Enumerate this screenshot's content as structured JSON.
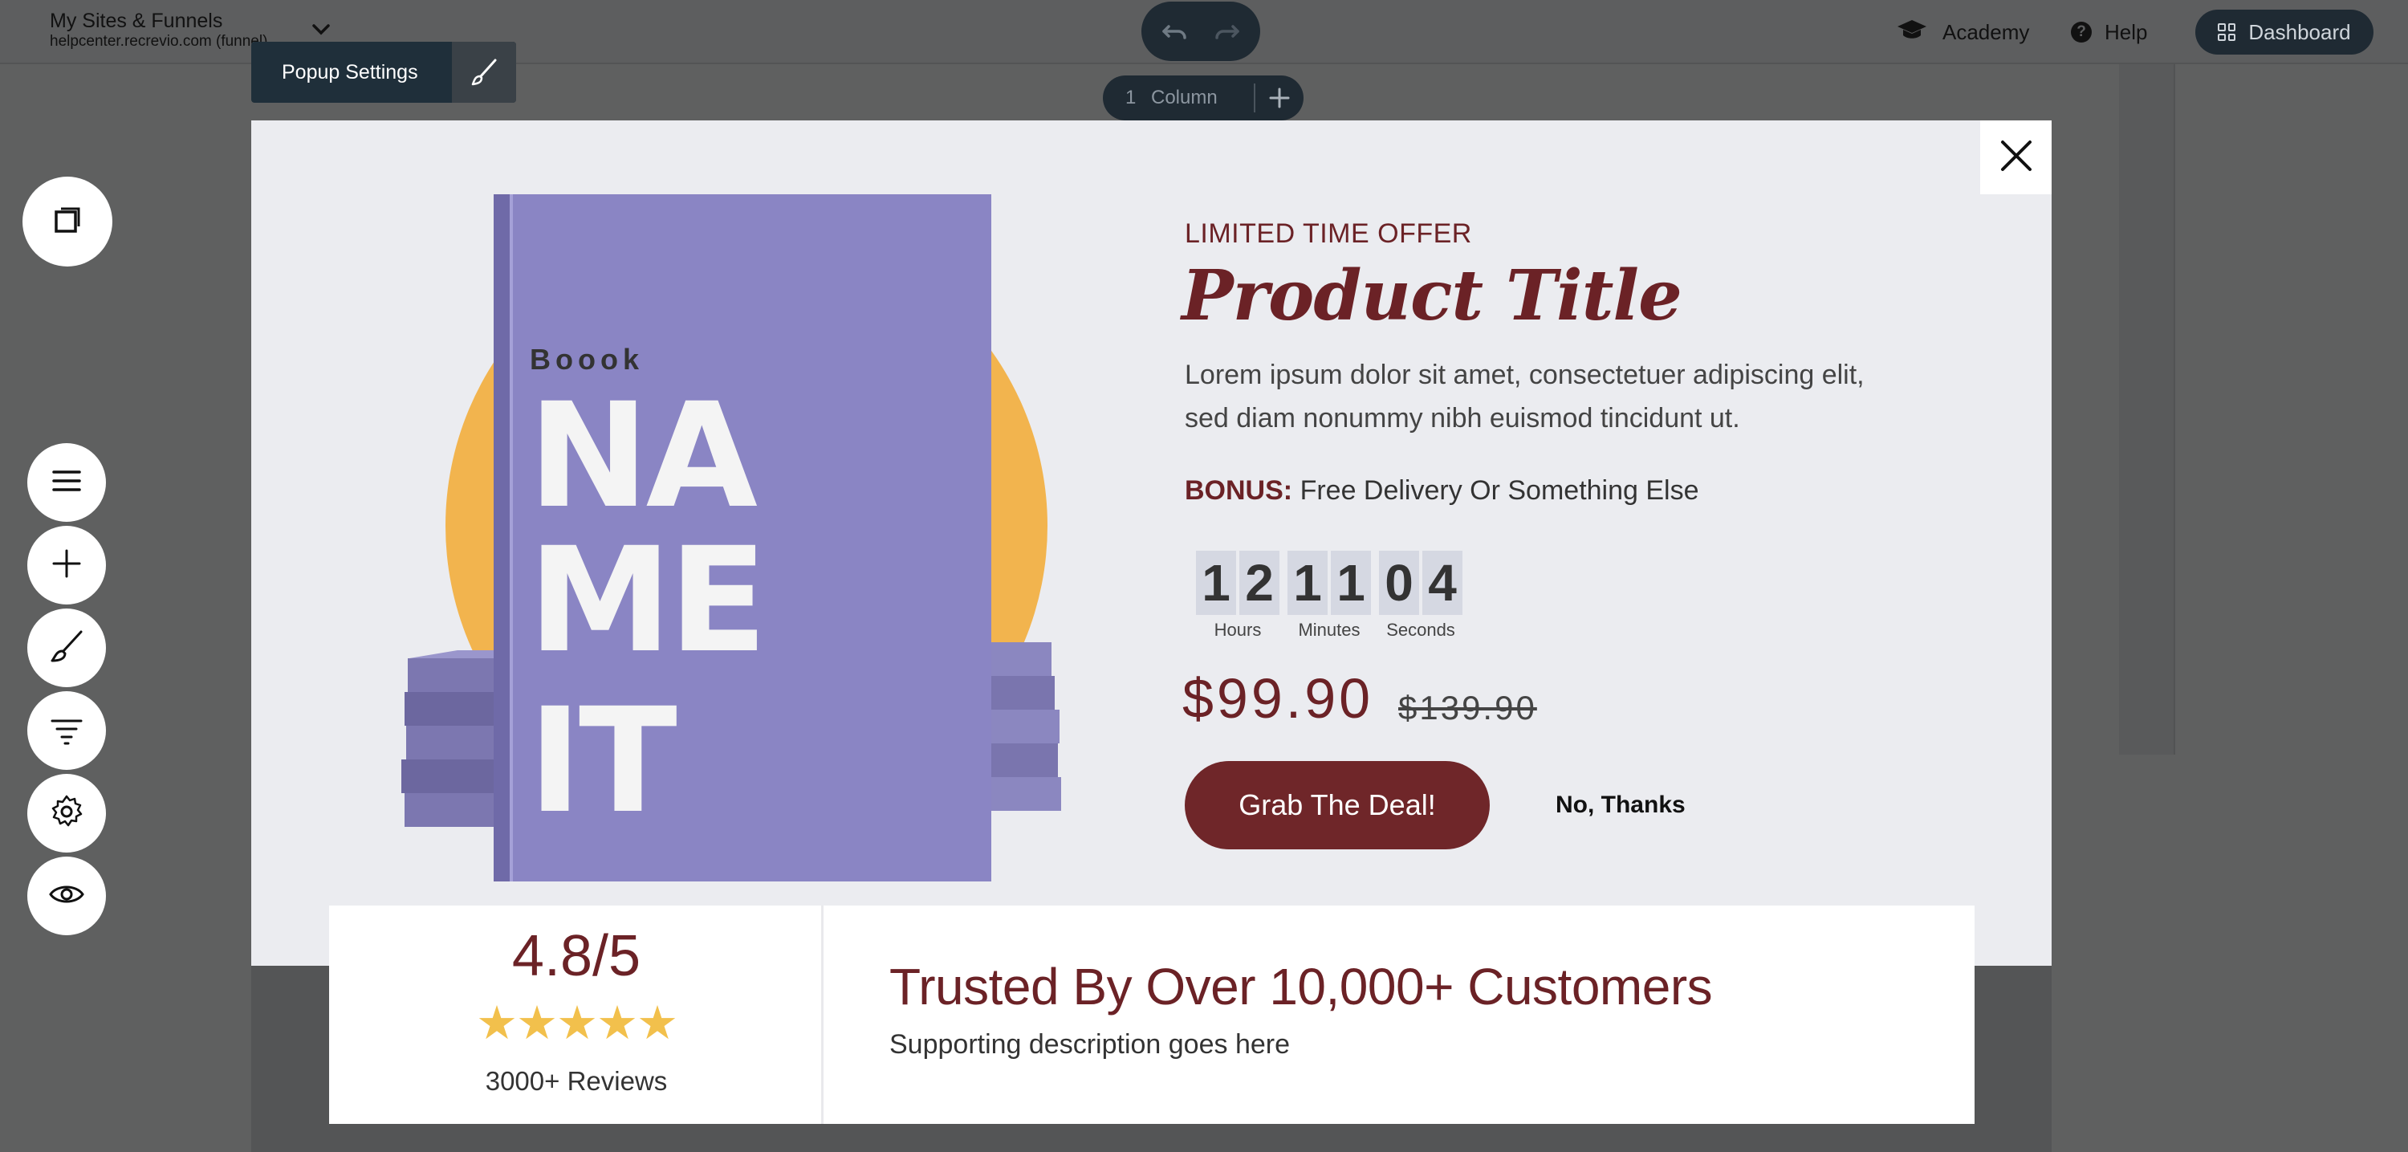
{
  "editor": {
    "site_title": "My Sites & Funnels",
    "site_url": "helpcenter.recrevio.com (funnel)",
    "academy_label": "Academy",
    "help_label": "Help",
    "dashboard_label": "Dashboard",
    "popup_settings_label": "Popup Settings",
    "column_count": "1",
    "column_label": "Column"
  },
  "toolbar": {
    "icons": [
      "layers-icon",
      "menu-icon",
      "add-icon",
      "brush-icon",
      "filter-icon",
      "gear-icon",
      "eye-icon"
    ]
  },
  "popup": {
    "book": {
      "small_title": "Boook",
      "big_title_lines": [
        "NA",
        "ME",
        "IT"
      ]
    },
    "kicker": "LIMITED TIME OFFER",
    "title": "Product Title",
    "description": "Lorem ipsum dolor sit amet, consectetuer adipiscing elit, sed diam nonummy nibh euismod tincidunt ut.",
    "bonus_label": "BONUS:",
    "bonus_text": "Free Delivery Or Something Else",
    "timer": {
      "hours": [
        "1",
        "2"
      ],
      "minutes": [
        "1",
        "1"
      ],
      "seconds": [
        "0",
        "4"
      ],
      "hours_label": "Hours",
      "minutes_label": "Minutes",
      "seconds_label": "Seconds"
    },
    "price": "$99.90",
    "old_price": "$139.90",
    "cta_label": "Grab The Deal!",
    "decline_label": "No, Thanks"
  },
  "rating": {
    "score": "4.8/5",
    "stars": "★★★★★",
    "reviews": "3000+ Reviews"
  },
  "trust": {
    "title": "Trusted By Over 10,000+ Customers",
    "subtitle": "Supporting description goes here"
  },
  "colors": {
    "accent": "#6b2226",
    "cta": "#6f2629",
    "book": "#8a85c4",
    "sun": "#f2b44e",
    "star": "#f2c04c",
    "popup_bg": "#ebecf0"
  }
}
